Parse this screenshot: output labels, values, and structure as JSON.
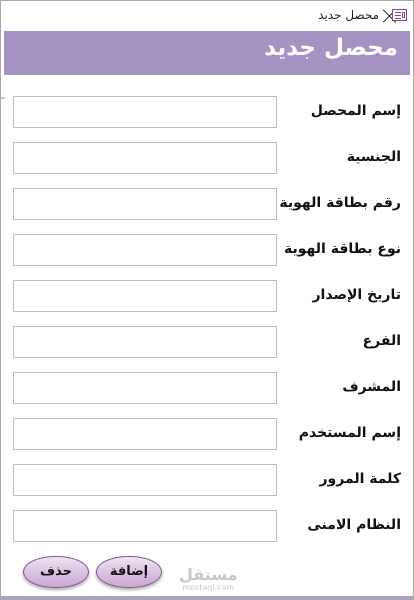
{
  "window": {
    "title": "محصل جديد"
  },
  "header": {
    "title": "محصل جديد"
  },
  "fields": [
    {
      "label": "إسم المحصل",
      "value": ""
    },
    {
      "label": "الجنسية",
      "value": ""
    },
    {
      "label": "رقم بطاقة الهوية",
      "value": ""
    },
    {
      "label": "نوع بطاقة الهوية",
      "value": ""
    },
    {
      "label": "تاريخ الإصدار",
      "value": ""
    },
    {
      "label": "الفرع",
      "value": ""
    },
    {
      "label": "المشرف",
      "value": ""
    },
    {
      "label": "إسم المستخدم",
      "value": ""
    },
    {
      "label": "كلمة المرور",
      "value": ""
    },
    {
      "label": "النظام الامنى",
      "value": ""
    }
  ],
  "buttons": {
    "delete": "حذف",
    "add": "إضافة"
  },
  "watermark": {
    "main": "مستقل",
    "sub": "mostaql.com"
  },
  "colors": {
    "header": "#a392c2",
    "button": "#d9bfe0"
  }
}
